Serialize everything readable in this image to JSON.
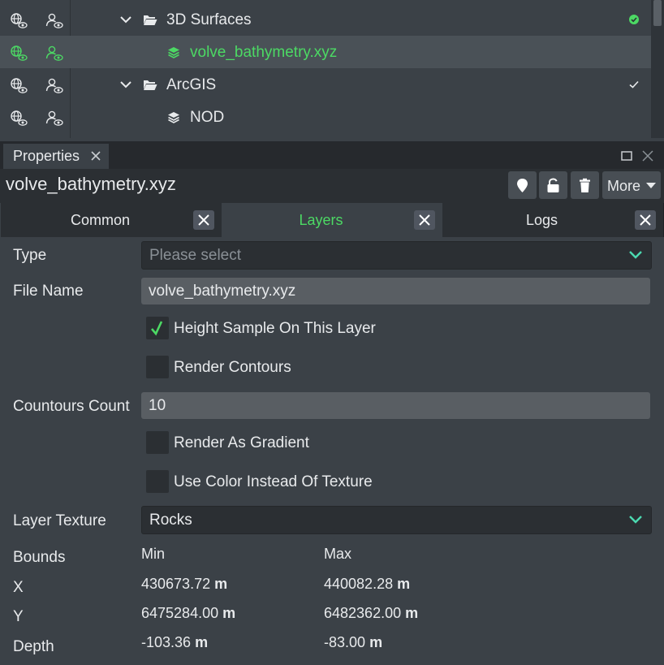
{
  "tree": {
    "rows": [
      {
        "label": "3D Surfaces",
        "type": "folder",
        "expanded": true,
        "status": "check-circle"
      },
      {
        "label": "volve_bathymetry.xyz",
        "type": "layer",
        "selected": true
      },
      {
        "label": "ArcGIS",
        "type": "folder",
        "expanded": true,
        "status": "check"
      },
      {
        "label": "NOD",
        "type": "layer"
      }
    ]
  },
  "panel": {
    "tab_label": "Properties",
    "title": "volve_bathymetry.xyz",
    "more_label": "More"
  },
  "tabs": [
    {
      "label": "Common",
      "active": false
    },
    {
      "label": "Layers",
      "active": true
    },
    {
      "label": "Logs",
      "active": false
    }
  ],
  "form": {
    "type_label": "Type",
    "type_placeholder": "Please select",
    "file_name_label": "File Name",
    "file_name_value": "volve_bathymetry.xyz",
    "height_sample_label": "Height Sample On This Layer",
    "height_sample_checked": true,
    "render_contours_label": "Render Contours",
    "render_contours_checked": false,
    "contours_count_label": "Countours Count",
    "contours_count_value": "10",
    "render_gradient_label": "Render As Gradient",
    "render_gradient_checked": false,
    "use_color_label": "Use Color Instead Of Texture",
    "use_color_checked": false,
    "layer_texture_label": "Layer Texture",
    "layer_texture_value": "Rocks"
  },
  "bounds": {
    "label": "Bounds",
    "min_header": "Min",
    "max_header": "Max",
    "unit": "m",
    "rows": [
      {
        "label": "X",
        "min": "430673.72",
        "max": "440082.28"
      },
      {
        "label": "Y",
        "min": "6475284.00",
        "max": "6482362.00"
      },
      {
        "label": "Depth",
        "min": "-103.36",
        "max": "-83.00"
      }
    ]
  },
  "colors": {
    "accent": "#4cd964",
    "background": "#3b4147",
    "dark": "#2b2f33"
  }
}
